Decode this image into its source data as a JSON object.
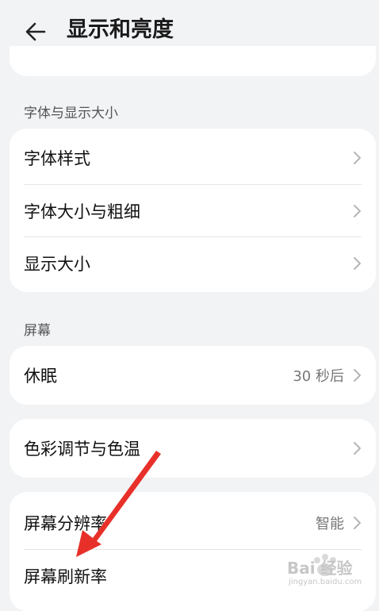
{
  "header": {
    "title": "显示和亮度",
    "back_icon": "back-arrow-icon"
  },
  "sections": {
    "font": "字体与显示大小",
    "screen": "屏幕"
  },
  "font_card": {
    "items": [
      {
        "label": "字体样式"
      },
      {
        "label": "字体大小与粗细"
      },
      {
        "label": "显示大小"
      }
    ]
  },
  "sleep_card": {
    "label": "休眠",
    "value": "30 秒后"
  },
  "color_card": {
    "label": "色彩调节与色温"
  },
  "screen_card": {
    "items": [
      {
        "label": "屏幕分辨率",
        "value": "智能"
      },
      {
        "label": "屏幕刷新率"
      }
    ]
  },
  "annotation": {
    "arrow_color": "#e8302a"
  },
  "watermark": {
    "text": "Bai 经验",
    "url": "jingyan.baidu.com"
  }
}
